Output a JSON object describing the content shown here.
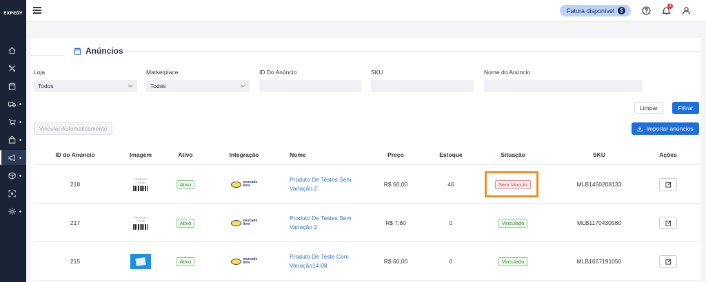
{
  "app": {
    "logo": "EXPEDY"
  },
  "topbar": {
    "fatura_label": "Fatura disponível",
    "coin_symbol": "$",
    "notification_count": "3"
  },
  "page": {
    "title": "Anúncios"
  },
  "filters": {
    "loja_label": "Loja",
    "loja_value": "Todos",
    "marketplace_label": "Marketplace",
    "marketplace_value": "Todos",
    "id_label": "ID Do Anúncio",
    "id_value": "",
    "sku_label": "SKU",
    "sku_value": "",
    "nome_label": "Nome do Anúncio",
    "nome_value": ""
  },
  "buttons": {
    "limpar": "Limpar",
    "filtrar": "Filtrar",
    "vincular": "Vincular Automaticamente",
    "importar": "Importar anúncios"
  },
  "table": {
    "headers": [
      "ID do Anúncio",
      "Imagem",
      "Ativo",
      "Integração",
      "Nome",
      "Preço",
      "Estoque",
      "Situação",
      "SKU",
      "Ações"
    ],
    "rows": [
      {
        "id": "218",
        "image": "produto-teste-barcode",
        "image_text": "PRODUTO TESTE",
        "ativo": "Ativo",
        "integracao": [
          "mercado",
          "livre"
        ],
        "nome": "Produto De Testes Sem Variação 2",
        "preco": "R$ 50,00",
        "estoque": "46",
        "situacao": "Sem Vinculo",
        "sku": "MLB1450208133"
      },
      {
        "id": "217",
        "image": "produto-teste-barcode",
        "image_text": "PRODUTO TESTE",
        "ativo": "Ativo",
        "integracao": [
          "mercado",
          "livre"
        ],
        "nome": "Produto De Testes Sem Variação 2",
        "preco": "R$ 7,80",
        "estoque": "0",
        "situacao": "Vinculado",
        "sku": "MLB1170430580"
      },
      {
        "id": "215",
        "image": "blue-product-thumbnail",
        "ativo": "Ativo",
        "integracao": [
          "mercado",
          "livre"
        ],
        "nome": "Produto De Teste Com Variação14-08",
        "preco": "R$ 60,00",
        "estoque": "0",
        "situacao": "Vinculado",
        "sku": "MLB1657191050"
      }
    ]
  },
  "colors": {
    "primary": "#1d6fe0",
    "sidebar": "#1b2437",
    "highlight": "#f78c1f",
    "fatura_bg": "#bcd3f7"
  }
}
